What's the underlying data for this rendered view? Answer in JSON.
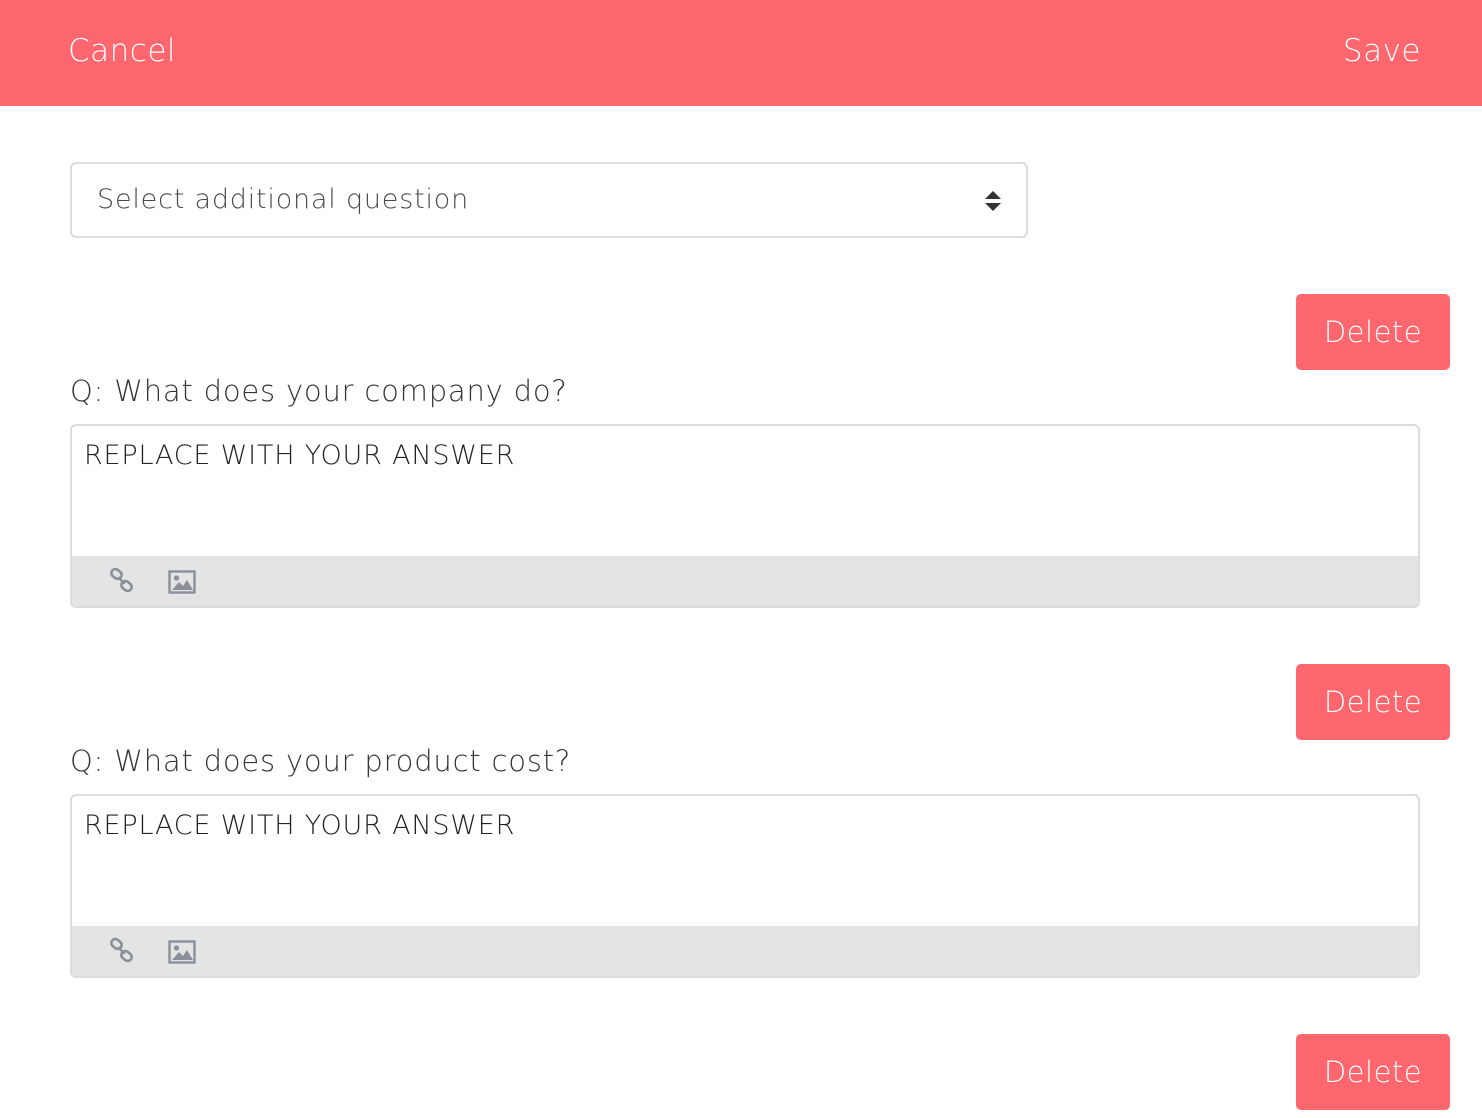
{
  "header": {
    "cancel_label": "Cancel",
    "save_label": "Save",
    "background_color": "#ff676e"
  },
  "question_select": {
    "placeholder": "Select additional question",
    "icon": "sort-arrows-icon"
  },
  "questions": [
    {
      "delete_label": "Delete",
      "question": "Q: What does your company do?",
      "answer": "REPLACE WITH YOUR ANSWER",
      "toolbar_icons": [
        "link-icon",
        "image-icon"
      ]
    },
    {
      "delete_label": "Delete",
      "question": "Q: What does your product cost?",
      "answer": "REPLACE WITH YOUR ANSWER",
      "toolbar_icons": [
        "link-icon",
        "image-icon"
      ]
    },
    {
      "delete_label": "Delete"
    }
  ],
  "colors": {
    "accent": "#ff676e",
    "toolbar_bg": "#e4e4e4",
    "border": "#dcdcdc",
    "icon_gray": "#8a9099"
  }
}
